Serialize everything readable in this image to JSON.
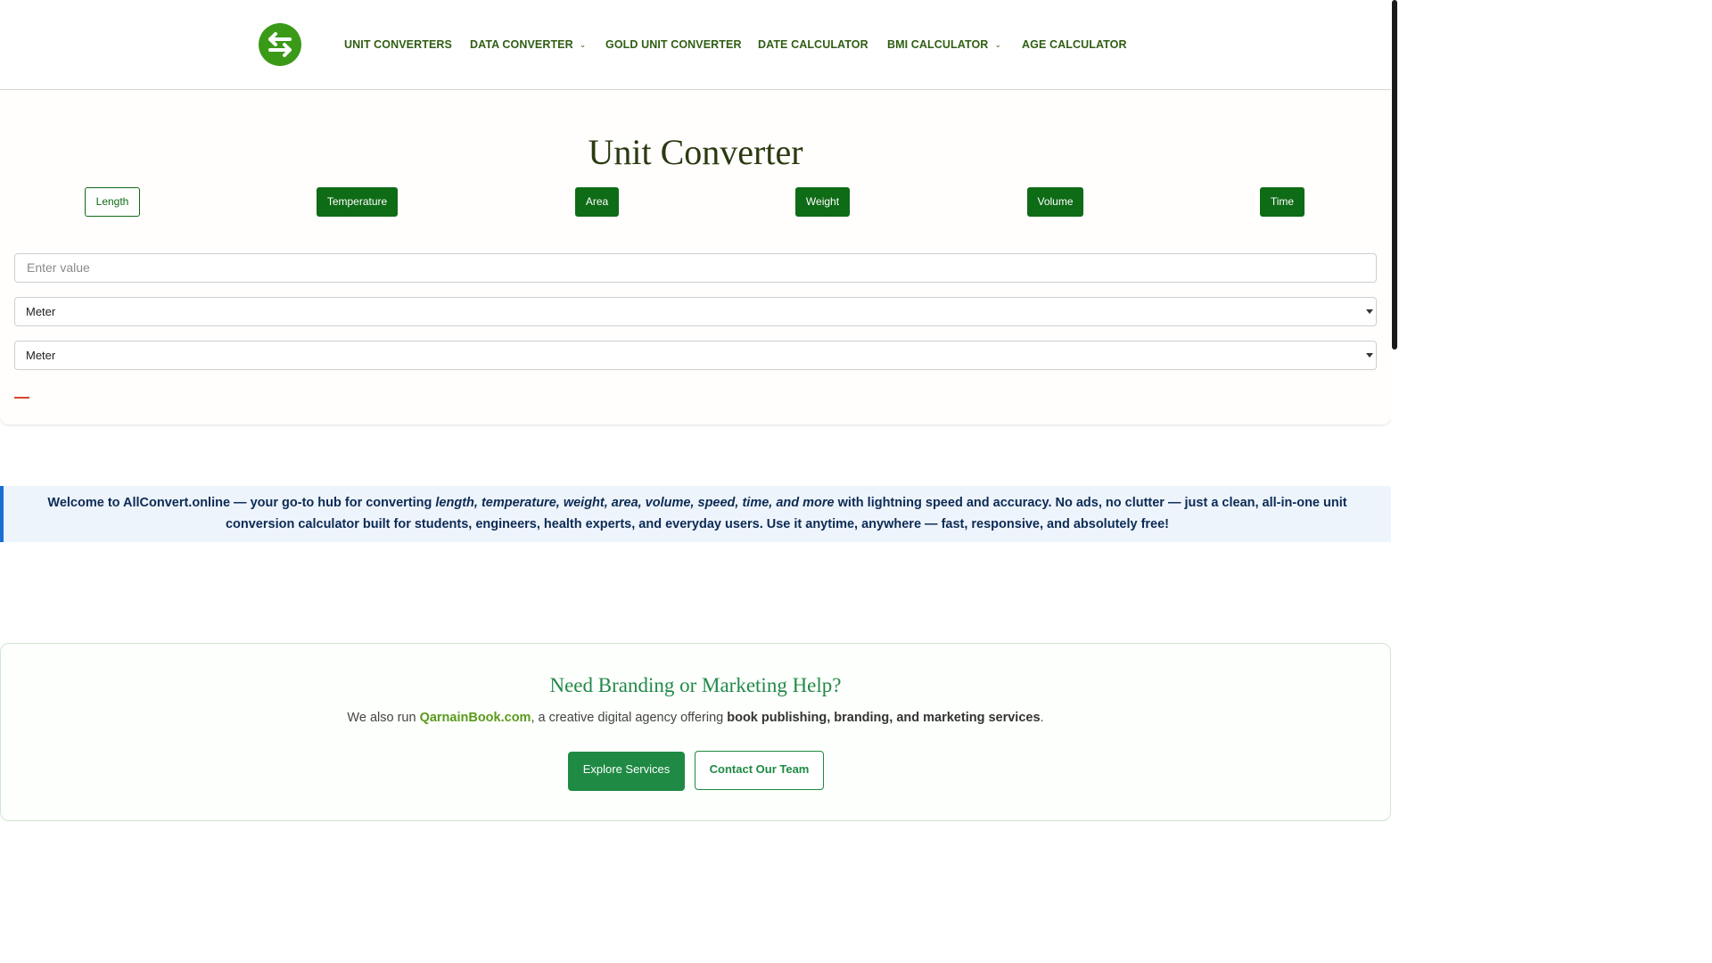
{
  "header": {
    "logo_icon": "swap-arrows-icon",
    "nav": [
      {
        "label": "UNIT CONVERTERS",
        "has_dropdown": false
      },
      {
        "label": "DATA CONVERTER",
        "has_dropdown": true
      },
      {
        "label": "GOLD UNIT CONVERTER",
        "has_dropdown": false
      },
      {
        "label": "DATE CALCULATOR",
        "has_dropdown": false
      },
      {
        "label": "BMI CALCULATOR",
        "has_dropdown": true
      },
      {
        "label": "AGE CALCULATOR",
        "has_dropdown": false
      }
    ]
  },
  "converter": {
    "title": "Unit Converter",
    "categories": [
      {
        "label": "Length",
        "active": true
      },
      {
        "label": "Temperature",
        "active": false
      },
      {
        "label": "Area",
        "active": false
      },
      {
        "label": "Weight",
        "active": false
      },
      {
        "label": "Volume",
        "active": false
      },
      {
        "label": "Time",
        "active": false
      }
    ],
    "value_input": {
      "value": "",
      "placeholder": "Enter value"
    },
    "from_unit": "Meter",
    "to_unit": "Meter",
    "result": ""
  },
  "welcome": {
    "lead": "Welcome to AllConvert.online — your go-to hub for converting ",
    "emphasis": "length, temperature, weight, area, volume, speed, time, and more",
    "tail": " with lightning speed and accuracy. No ads, no clutter — just a clean, all-in-one unit conversion calculator built for students, engineers, health experts, and everyday users. Use it anytime, anywhere — fast, responsive, and absolutely free!"
  },
  "branding": {
    "title": "Need Branding or Marketing Help?",
    "text_before": "We also run ",
    "link_text": "QarnainBook.com",
    "text_middle": ", a creative digital agency offering ",
    "strong_text": "book publishing, branding, and marketing services",
    "text_after": ".",
    "explore_label": "Explore Services",
    "contact_label": "Contact Our Team"
  },
  "colors": {
    "brand_green": "#3a9a17",
    "nav_text": "#2f5e12",
    "button_green": "#0e6b16",
    "banner_accent": "#1a6fd4",
    "cta_green": "#1e8a44"
  }
}
